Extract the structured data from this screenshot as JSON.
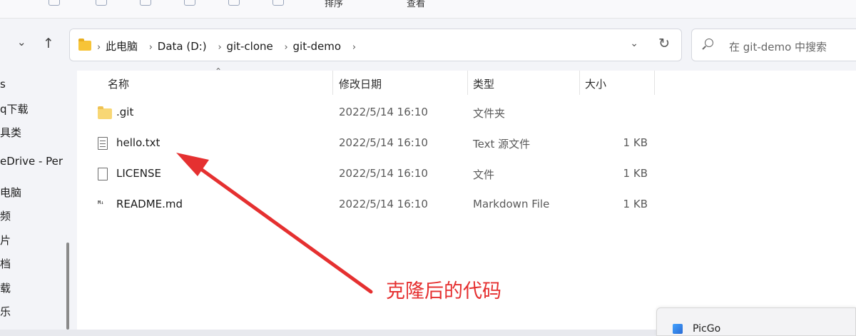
{
  "toolbar": {
    "sort_label": "排序",
    "view_label": "查看"
  },
  "nav": {
    "back_glyph": "⌄",
    "up_glyph": "↑"
  },
  "address": {
    "crumbs": [
      "此电脑",
      "Data (D:)",
      "git-clone",
      "git-demo"
    ],
    "separator": "›"
  },
  "search": {
    "placeholder": "在 git-demo 中搜索"
  },
  "sidebar": {
    "items": [
      "s",
      "q下载",
      "具类",
      "eDrive - Per",
      "电脑",
      "频",
      "片",
      "档",
      "载",
      "乐"
    ]
  },
  "columns": {
    "name": "名称",
    "date": "修改日期",
    "type": "类型",
    "size": "大小"
  },
  "files": [
    {
      "name": ".git",
      "date": "2022/5/14 16:10",
      "type": "文件夹",
      "size": "",
      "icon": "folder-icon"
    },
    {
      "name": "hello.txt",
      "date": "2022/5/14 16:10",
      "type": "Text 源文件",
      "size": "1 KB",
      "icon": "text-file-icon"
    },
    {
      "name": "LICENSE",
      "date": "2022/5/14 16:10",
      "type": "文件",
      "size": "1 KB",
      "icon": "file-icon"
    },
    {
      "name": "README.md",
      "date": "2022/5/14 16:10",
      "type": "Markdown File",
      "size": "1 KB",
      "icon": "markdown-icon"
    }
  ],
  "annotation": {
    "text": "克隆后的代码",
    "color": "#e53030"
  },
  "taskbar_popup": {
    "label": "PicGo"
  },
  "colors": {
    "accent_arrow": "#e53030",
    "folder": "#f8d775"
  }
}
